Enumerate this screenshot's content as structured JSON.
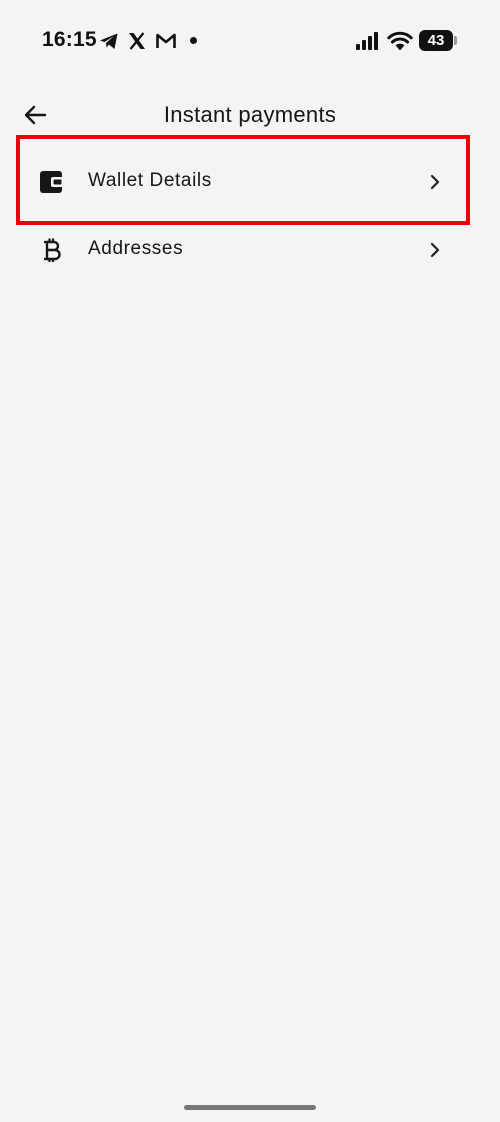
{
  "status_bar": {
    "time": "16:15",
    "battery": "43",
    "notification_icons": [
      "telegram-icon",
      "x-icon",
      "gmail-icon"
    ]
  },
  "header": {
    "back_icon": "arrow-left-icon",
    "title": "Instant payments"
  },
  "menu": {
    "items": [
      {
        "label": "Wallet Details",
        "icon": "wallet-icon",
        "highlighted": true
      },
      {
        "label": "Addresses",
        "icon": "bitcoin-icon",
        "highlighted": false
      }
    ]
  },
  "colors": {
    "background": "#f4f4f4",
    "text": "#161616",
    "highlight_border": "#e8000b"
  }
}
